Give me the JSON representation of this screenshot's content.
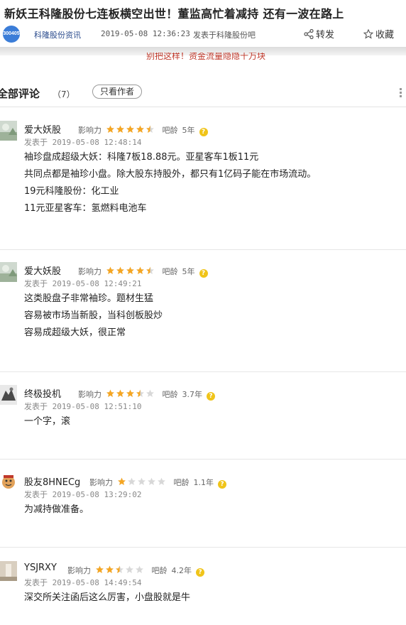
{
  "article": {
    "title": "新妖王科隆股份七连板横空出世！董监高忙着减持 还有一波在路上",
    "avatar_text": "300405",
    "source": "科隆股份资讯",
    "time": "2019-05-08 12:36:23",
    "posted_in": "发表于科隆股份吧",
    "share_label": "转发",
    "fav_label": "收藏",
    "cut_text": "别把这样！资金流量隐隐十万块"
  },
  "tabs": {
    "all_label": "全部评论",
    "count": "（7）",
    "author_only": "只看作者"
  },
  "labels": {
    "influence": "影响力",
    "bar_age": "吧龄",
    "posted": "发表于"
  },
  "colors": {
    "star": "#f5a623",
    "star_empty": "#d8d8d8",
    "link": "#2a4b8d",
    "accent": "#3b7dd8"
  },
  "comments": [
    {
      "name": "爱大妖股",
      "rating": 4.5,
      "bar_age": "5年",
      "date": "2019-05-08 12:48:14",
      "lines": [
        "袖珍盘成超级大妖：科隆7板18.88元。亚星客车1板11元",
        "共同点都是袖珍小盘。除大股东持股外，都只有1亿码子能在市场流动。",
        "19元科隆股份：化工业",
        "11元亚星客车：氢燃料电池车"
      ]
    },
    {
      "name": "爱大妖股",
      "rating": 4.5,
      "bar_age": "5年",
      "date": "2019-05-08 12:49:21",
      "lines": [
        "这类股盘子非常袖珍。题材生猛",
        "容易被市场当新股，当科创板股炒",
        "容易成超级大妖，很正常"
      ]
    },
    {
      "name": "终极投机",
      "rating": 3.5,
      "bar_age": "3.7年",
      "date": "2019-05-08 12:51:10",
      "lines": [
        "一个字，滚"
      ]
    },
    {
      "name": "股友8HNECg",
      "rating": 1,
      "bar_age": "1.1年",
      "date": "2019-05-08 13:29:02",
      "lines": [
        "为减持做准备。"
      ]
    },
    {
      "name": "YSJRXY",
      "rating": 2.5,
      "bar_age": "4.2年",
      "date": "2019-05-08 14:49:54",
      "lines": [
        "深交所关注函后这么厉害，小盘股就是牛"
      ]
    }
  ]
}
